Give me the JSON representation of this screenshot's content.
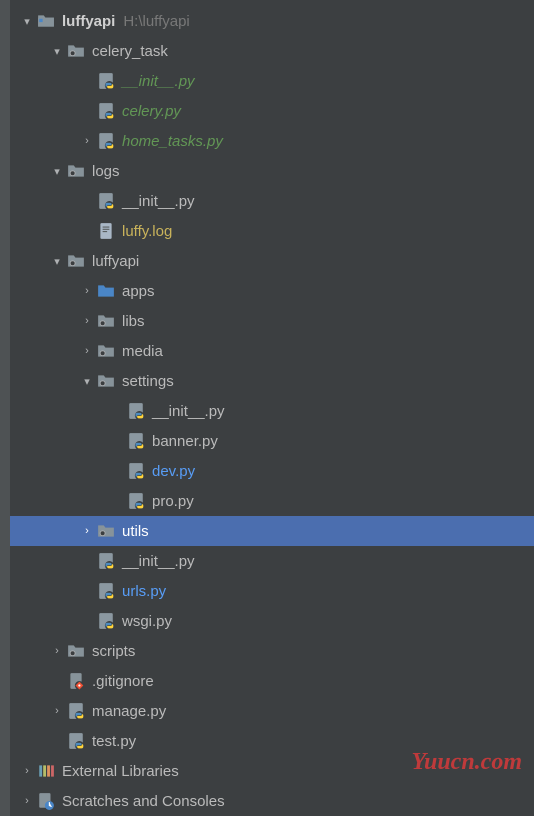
{
  "root": {
    "name": "luffyapi",
    "path": "H:\\luffyapi"
  },
  "tree": [
    {
      "id": "celery_task",
      "label": "celery_task",
      "depth": 1,
      "kind": "package",
      "expand": "open"
    },
    {
      "id": "celery_task_init",
      "label": "__init__.py",
      "depth": 2,
      "kind": "pyfile",
      "color": "green",
      "expand": "none"
    },
    {
      "id": "celery_py",
      "label": "celery.py",
      "depth": 2,
      "kind": "pyfile",
      "color": "green",
      "expand": "none"
    },
    {
      "id": "home_tasks",
      "label": "home_tasks.py",
      "depth": 2,
      "kind": "pyfile",
      "color": "green",
      "expand": "closed"
    },
    {
      "id": "logs",
      "label": "logs",
      "depth": 1,
      "kind": "package",
      "expand": "open"
    },
    {
      "id": "logs_init",
      "label": "__init__.py",
      "depth": 2,
      "kind": "pyfile",
      "expand": "none"
    },
    {
      "id": "luffy_log",
      "label": "luffy.log",
      "depth": 2,
      "kind": "textfile",
      "color": "yellow",
      "expand": "none"
    },
    {
      "id": "luffyapi_pkg",
      "label": "luffyapi",
      "depth": 1,
      "kind": "package",
      "expand": "open"
    },
    {
      "id": "apps",
      "label": "apps",
      "depth": 2,
      "kind": "folder-blue",
      "expand": "closed"
    },
    {
      "id": "libs",
      "label": "libs",
      "depth": 2,
      "kind": "package",
      "expand": "closed"
    },
    {
      "id": "media",
      "label": "media",
      "depth": 2,
      "kind": "package",
      "expand": "closed"
    },
    {
      "id": "settings",
      "label": "settings",
      "depth": 2,
      "kind": "package",
      "expand": "open"
    },
    {
      "id": "settings_init",
      "label": "__init__.py",
      "depth": 3,
      "kind": "pyfile",
      "expand": "none"
    },
    {
      "id": "banner",
      "label": "banner.py",
      "depth": 3,
      "kind": "pyfile",
      "expand": "none"
    },
    {
      "id": "dev",
      "label": "dev.py",
      "depth": 3,
      "kind": "pyfile",
      "color": "blue",
      "expand": "none"
    },
    {
      "id": "pro",
      "label": "pro.py",
      "depth": 3,
      "kind": "pyfile",
      "expand": "none"
    },
    {
      "id": "utils",
      "label": "utils",
      "depth": 2,
      "kind": "package",
      "expand": "closed",
      "selected": true
    },
    {
      "id": "luffyapi_init",
      "label": "__init__.py",
      "depth": 2,
      "kind": "pyfile",
      "expand": "none"
    },
    {
      "id": "urls",
      "label": "urls.py",
      "depth": 2,
      "kind": "pyfile",
      "color": "blue",
      "expand": "none"
    },
    {
      "id": "wsgi",
      "label": "wsgi.py",
      "depth": 2,
      "kind": "pyfile",
      "expand": "none"
    },
    {
      "id": "scripts",
      "label": "scripts",
      "depth": 1,
      "kind": "package",
      "expand": "closed"
    },
    {
      "id": "gitignore",
      "label": ".gitignore",
      "depth": 1,
      "kind": "gitignore",
      "expand": "none"
    },
    {
      "id": "manage",
      "label": "manage.py",
      "depth": 1,
      "kind": "pyfile",
      "expand": "closed"
    },
    {
      "id": "testpy",
      "label": "test.py",
      "depth": 1,
      "kind": "pyfile",
      "expand": "none"
    }
  ],
  "footer": [
    {
      "id": "ext_lib",
      "label": "External Libraries",
      "depth": 0,
      "kind": "libraries",
      "expand": "closed"
    },
    {
      "id": "scratches",
      "label": "Scratches and Consoles",
      "depth": 0,
      "kind": "scratches",
      "expand": "closed"
    }
  ],
  "watermark": "Yuucn.com"
}
